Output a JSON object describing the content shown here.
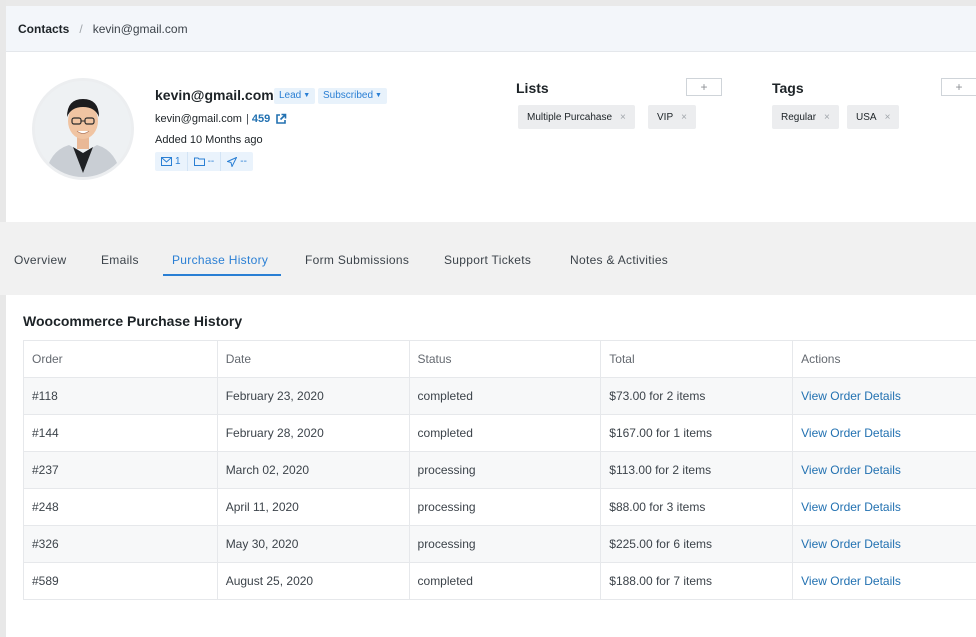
{
  "breadcrumb": {
    "root": "Contacts",
    "separator": "/",
    "current": "kevin@gmail.com"
  },
  "contact": {
    "name": "kevin@gmail.com",
    "status_pill": "Lead",
    "subscription_pill": "Subscribed",
    "email": "kevin@gmail.com",
    "email_separator": "|",
    "order_count": "459",
    "added": "Added 10 Months ago",
    "stats": {
      "emails": "1",
      "folders": "--",
      "sent": "--"
    }
  },
  "lists": {
    "title": "Lists",
    "add_label": "+",
    "items": [
      "Multiple Purcahase",
      "VIP"
    ],
    "remove_glyph": "×"
  },
  "tags": {
    "title": "Tags",
    "add_label": "+",
    "items": [
      "Regular",
      "USA"
    ],
    "remove_glyph": "×"
  },
  "tabs": [
    "Overview",
    "Emails",
    "Purchase History",
    "Form Submissions",
    "Support Tickets",
    "Notes & Activities"
  ],
  "active_tab": "Purchase History",
  "purchases": {
    "title": "Woocommerce Purchase History",
    "columns": [
      "Order",
      "Date",
      "Status",
      "Total",
      "Actions"
    ],
    "rows": [
      {
        "order": "#118",
        "date": "February 23, 2020",
        "status": "completed",
        "total": "$73.00 for 2 items",
        "action": "View Order Details"
      },
      {
        "order": "#144",
        "date": "February 28, 2020",
        "status": "completed",
        "total": "$167.00 for 1 items",
        "action": "View Order Details"
      },
      {
        "order": "#237",
        "date": "March 02, 2020",
        "status": "processing",
        "total": "$113.00 for 2 items",
        "action": "View Order Details"
      },
      {
        "order": "#248",
        "date": "April 11, 2020",
        "status": "processing",
        "total": "$88.00 for 3 items",
        "action": "View Order Details"
      },
      {
        "order": "#326",
        "date": "May 30, 2020",
        "status": "processing",
        "total": "$225.00 for 6 items",
        "action": "View Order Details"
      },
      {
        "order": "#589",
        "date": "August 25, 2020",
        "status": "completed",
        "total": "$188.00 for 7 items",
        "action": "View Order Details"
      }
    ]
  },
  "colors": {
    "accent": "#2a7fd4",
    "link": "#2271b1",
    "pill_bg": "#e8f2fb"
  },
  "icons": {
    "external_link": "external-link-icon",
    "email": "envelope-icon",
    "folder": "folder-icon",
    "sent": "paper-plane-icon"
  }
}
